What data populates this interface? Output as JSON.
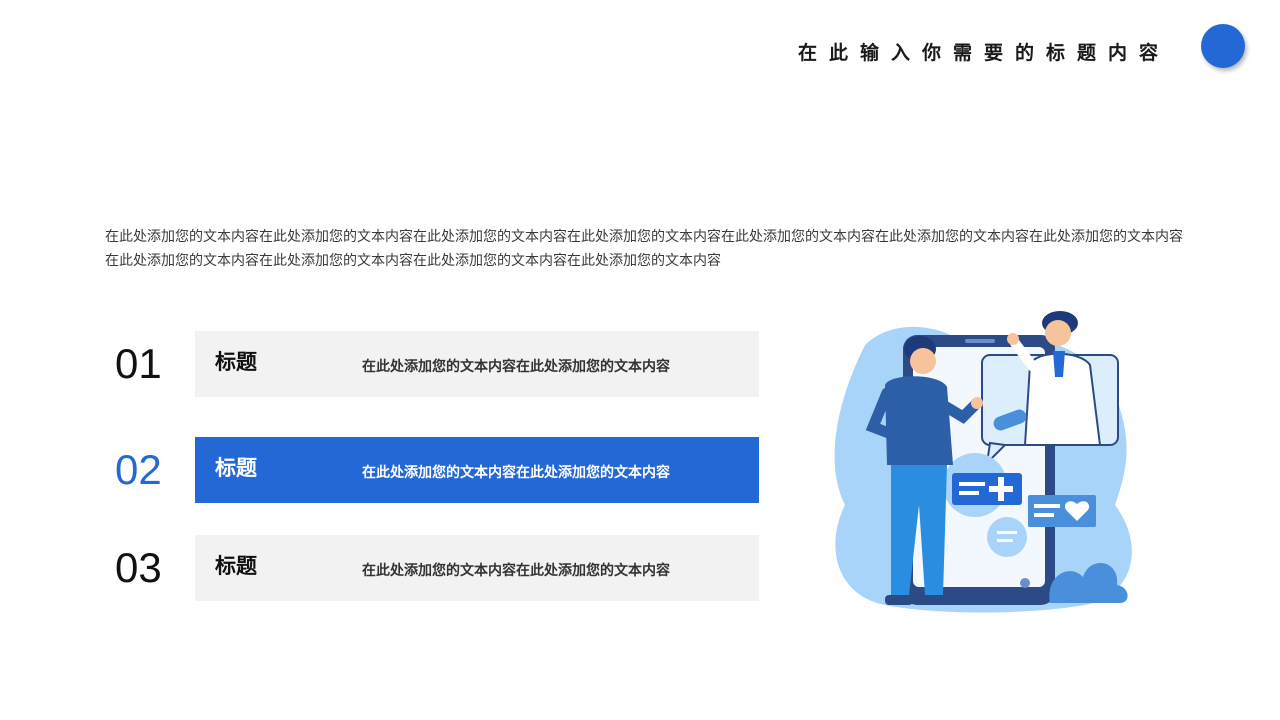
{
  "header": {
    "title": "在此输入你需要的标题内容"
  },
  "intro": {
    "text": "在此处添加您的文本内容在此处添加您的文本内容在此处添加您的文本内容在此处添加您的文本内容在此处添加您的文本内容在此处添加您的文本内容在此处添加您的文本内容在此处添加您的文本内容在此处添加您的文本内容在此处添加您的文本内容在此处添加您的文本内容"
  },
  "items": [
    {
      "number": "01",
      "label": "标题",
      "text": "在此处添加您的文本内容在此处添加您的文本内容"
    },
    {
      "number": "02",
      "label": "标题",
      "text": "在此处添加您的文本内容在此处添加您的文本内容"
    },
    {
      "number": "03",
      "label": "标题",
      "text": "在此处添加您的文本内容在此处添加您的文本内容"
    }
  ],
  "colors": {
    "accent": "#2468d6",
    "bar": "#f2f2f2",
    "illustration_light": "#a8d4fa",
    "illustration_dark": "#2c4a86"
  },
  "illustration": {
    "icon": "doctor-consultation-illustration"
  }
}
